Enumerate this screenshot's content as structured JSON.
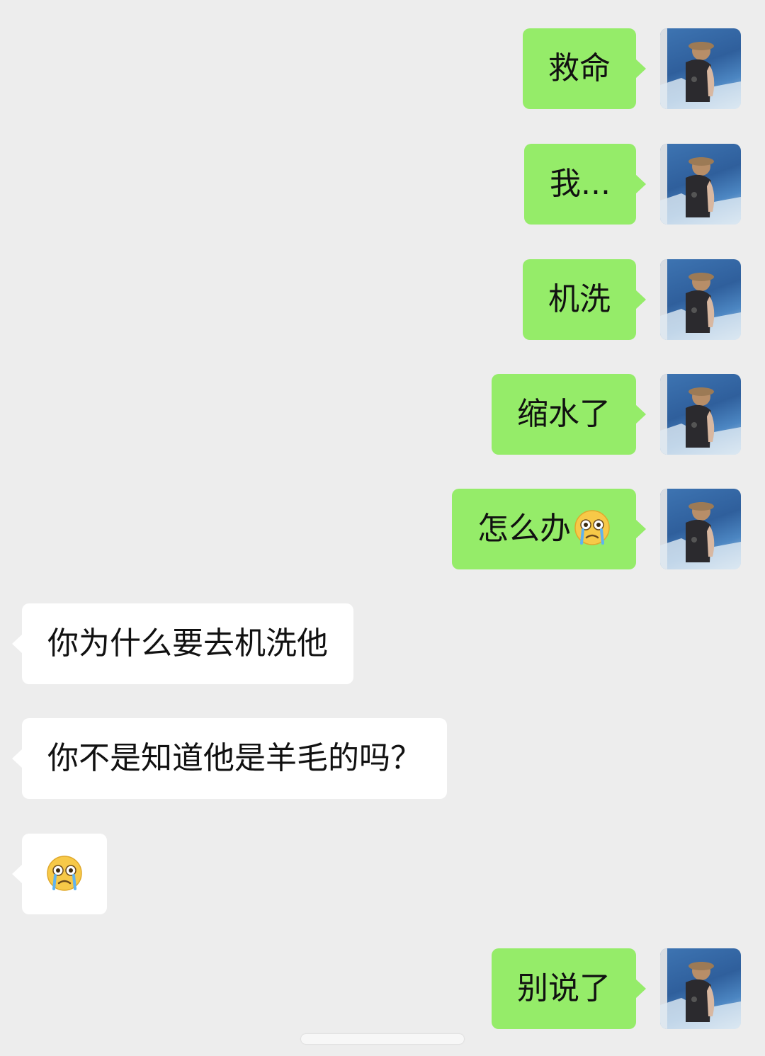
{
  "messages": [
    {
      "side": "me",
      "text": "救命"
    },
    {
      "side": "me",
      "text": "我..."
    },
    {
      "side": "me",
      "text": "机洗"
    },
    {
      "side": "me",
      "text": "缩水了"
    },
    {
      "side": "me",
      "text": "怎么办",
      "emoji": "crying-face-emoji"
    },
    {
      "side": "them",
      "text": "你为什么要去机洗他"
    },
    {
      "side": "them",
      "text": "你不是知道他是羊毛的吗？"
    },
    {
      "side": "them",
      "text": "",
      "emoji": "crying-face-emoji"
    },
    {
      "side": "me",
      "text": "别说了"
    }
  ],
  "colors": {
    "background": "#ededed",
    "sent_bubble": "#95ec69",
    "received_bubble": "#ffffff"
  }
}
